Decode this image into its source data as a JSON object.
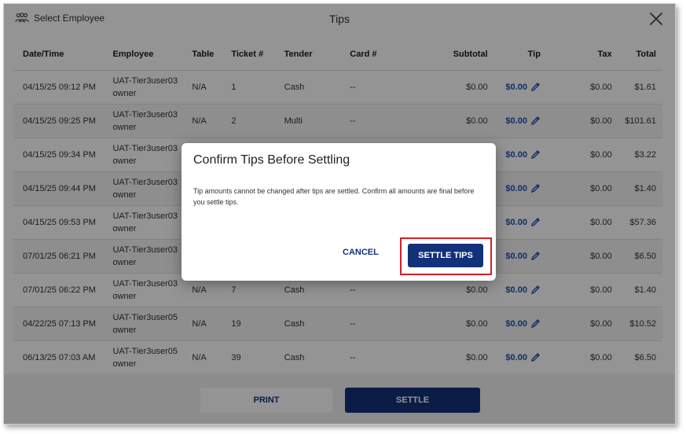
{
  "header": {
    "select_employee_label": "Select Employee",
    "title": "Tips"
  },
  "table": {
    "columns": [
      "Date/Time",
      "Employee",
      "Table",
      "Ticket #",
      "Tender",
      "Card #",
      "Subtotal",
      "Tip",
      "Tax",
      "Total"
    ],
    "rows": [
      {
        "datetime": "04/15/25 09:12 PM",
        "emp_line1": "UAT-Tier3user03",
        "emp_line2": "owner",
        "table": "N/A",
        "ticket": "1",
        "tender": "Cash",
        "card": "--",
        "subtotal": "$0.00",
        "tip": "$0.00",
        "tax": "$0.00",
        "total": "$1.61"
      },
      {
        "datetime": "04/15/25 09:25 PM",
        "emp_line1": "UAT-Tier3user03",
        "emp_line2": "owner",
        "table": "N/A",
        "ticket": "2",
        "tender": "Multi",
        "card": "--",
        "subtotal": "$0.00",
        "tip": "$0.00",
        "tax": "$0.00",
        "total": "$101.61"
      },
      {
        "datetime": "04/15/25 09:34 PM",
        "emp_line1": "UAT-Tier3user03",
        "emp_line2": "owner",
        "table": "",
        "ticket": "",
        "tender": "",
        "card": "",
        "subtotal": "",
        "tip": "$0.00",
        "tax": "$0.00",
        "total": "$3.22"
      },
      {
        "datetime": "04/15/25 09:44 PM",
        "emp_line1": "UAT-Tier3user03",
        "emp_line2": "owner",
        "table": "",
        "ticket": "",
        "tender": "",
        "card": "",
        "subtotal": "",
        "tip": "$0.00",
        "tax": "$0.00",
        "total": "$1.40"
      },
      {
        "datetime": "04/15/25 09:53 PM",
        "emp_line1": "UAT-Tier3user03",
        "emp_line2": "owner",
        "table": "",
        "ticket": "",
        "tender": "",
        "card": "",
        "subtotal": "",
        "tip": "$0.00",
        "tax": "$0.00",
        "total": "$57.36"
      },
      {
        "datetime": "07/01/25 06:21 PM",
        "emp_line1": "UAT-Tier3user03",
        "emp_line2": "owner",
        "table": "",
        "ticket": "",
        "tender": "",
        "card": "",
        "subtotal": "",
        "tip": "$0.00",
        "tax": "$0.00",
        "total": "$6.50"
      },
      {
        "datetime": "07/01/25 06:22 PM",
        "emp_line1": "UAT-Tier3user03",
        "emp_line2": "owner",
        "table": "N/A",
        "ticket": "7",
        "tender": "Cash",
        "card": "--",
        "subtotal": "$0.00",
        "tip": "$0.00",
        "tax": "$0.00",
        "total": "$1.40"
      },
      {
        "datetime": "04/22/25 07:13 PM",
        "emp_line1": "UAT-Tier3user05",
        "emp_line2": "owner",
        "table": "N/A",
        "ticket": "19",
        "tender": "Cash",
        "card": "--",
        "subtotal": "$0.00",
        "tip": "$0.00",
        "tax": "$0.00",
        "total": "$10.52"
      },
      {
        "datetime": "06/13/25 07:03 AM",
        "emp_line1": "UAT-Tier3user05",
        "emp_line2": "owner",
        "table": "N/A",
        "ticket": "39",
        "tender": "Cash",
        "card": "--",
        "subtotal": "$0.00",
        "tip": "$0.00",
        "tax": "$0.00",
        "total": "$6.50"
      }
    ]
  },
  "footer": {
    "print_label": "PRINT",
    "settle_label": "SETTLE"
  },
  "dialog": {
    "title": "Confirm Tips Before Settling",
    "message": "Tip amounts cannot be changed after tips are settled. Confirm all amounts are final before you settle tips.",
    "cancel_label": "CANCEL",
    "settle_tips_label": "SETTLE TIPS"
  },
  "colors": {
    "primary": "#13317a",
    "tip_link": "#1f4fb8",
    "highlight": "#d0202a"
  },
  "icons": [
    "people-icon",
    "close-icon",
    "pencil-icon"
  ]
}
